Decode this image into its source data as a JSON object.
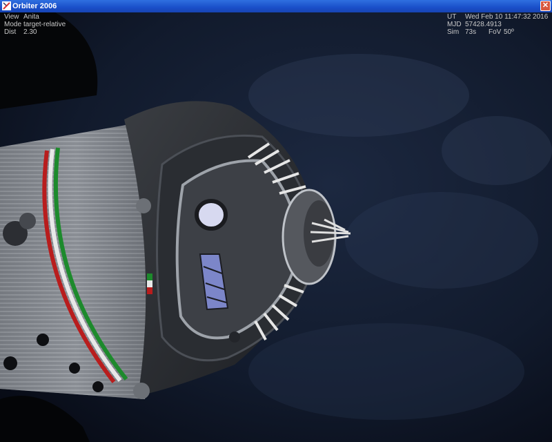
{
  "window": {
    "title": "Orbiter 2006",
    "close_glyph": "✕"
  },
  "hud_left": [
    {
      "key": "View",
      "value": "Anita"
    },
    {
      "key": "Mode",
      "value": "target-relative"
    },
    {
      "key": "Dist",
      "value": "2.30"
    }
  ],
  "hud_right": {
    "ut_label": "UT",
    "ut_value": "Wed Feb 10 11:47:32 2016",
    "mjd_label": "MJD",
    "mjd_value": "57428.4913",
    "sim_label": "Sim",
    "sim_value": "73s",
    "fov_label": "FoV",
    "fov_value": "50º"
  },
  "colors": {
    "titlebar": "#1a4fc9",
    "hud_text": "#c9c9c9",
    "space": "#0b0f1c",
    "hull": "#8a8f96",
    "stripe_red": "#b81d1d",
    "stripe_white": "#e8e8e8",
    "stripe_green": "#1d8a2c"
  },
  "icons": {
    "app": "orbiter-app-icon",
    "close": "close-icon"
  }
}
